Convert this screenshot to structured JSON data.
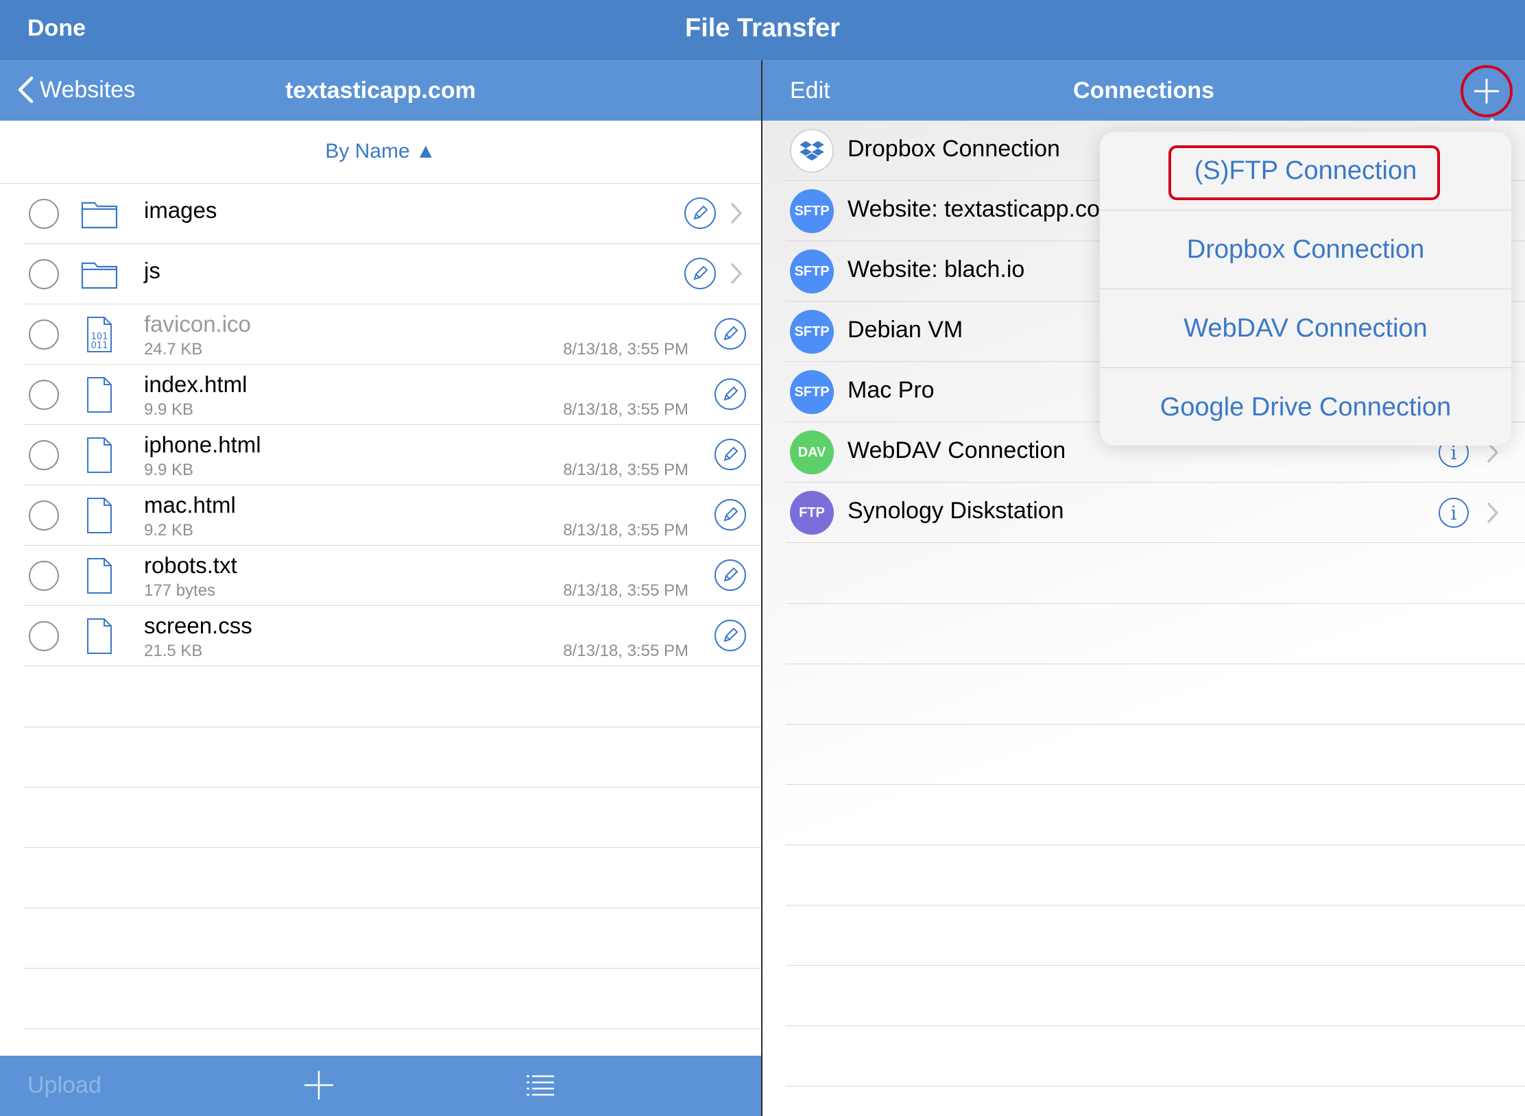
{
  "topbar": {
    "done": "Done",
    "title": "File Transfer"
  },
  "left": {
    "back_label": "Websites",
    "title": "textasticapp.com",
    "sort_label": "By Name ▲",
    "files": [
      {
        "name": "images",
        "type": "folder"
      },
      {
        "name": "js",
        "type": "folder"
      },
      {
        "name": "favicon.ico",
        "type": "binary",
        "size": "24.7 KB",
        "date": "8/13/18, 3:55 PM"
      },
      {
        "name": "index.html",
        "type": "file",
        "size": "9.9 KB",
        "date": "8/13/18, 3:55 PM"
      },
      {
        "name": "iphone.html",
        "type": "file",
        "size": "9.9 KB",
        "date": "8/13/18, 3:55 PM"
      },
      {
        "name": "mac.html",
        "type": "file",
        "size": "9.2 KB",
        "date": "8/13/18, 3:55 PM"
      },
      {
        "name": "robots.txt",
        "type": "file",
        "size": "177 bytes",
        "date": "8/13/18, 3:55 PM"
      },
      {
        "name": "screen.css",
        "type": "file",
        "size": "21.5 KB",
        "date": "8/13/18, 3:55 PM"
      }
    ],
    "binary_icon_text": [
      "101",
      "011"
    ],
    "upload_label": "Upload"
  },
  "right": {
    "edit_label": "Edit",
    "title": "Connections",
    "connections": [
      {
        "name": "Dropbox Connection",
        "badge": "",
        "color": "#ffffff"
      },
      {
        "name": "Website: textasticapp.com",
        "badge": "SFTP",
        "color": "#4e8ef7"
      },
      {
        "name": "Website: blach.io",
        "badge": "SFTP",
        "color": "#4e8ef7"
      },
      {
        "name": "Debian VM",
        "badge": "SFTP",
        "color": "#4e8ef7"
      },
      {
        "name": "Mac Pro",
        "badge": "SFTP",
        "color": "#4e8ef7"
      },
      {
        "name": "WebDAV Connection",
        "badge": "DAV",
        "color": "#5dd06a"
      },
      {
        "name": "Synology Diskstation",
        "badge": "FTP",
        "color": "#7a6fd8"
      }
    ],
    "info_glyph": "i"
  },
  "popover": {
    "items": [
      "(S)FTP Connection",
      "Dropbox Connection",
      "WebDAV Connection",
      "Google Drive Connection"
    ]
  },
  "colors": {
    "accent": "#3a78c9",
    "bar": "#4a82c8",
    "navbar": "#5b93d6",
    "highlight": "#d0021b"
  }
}
